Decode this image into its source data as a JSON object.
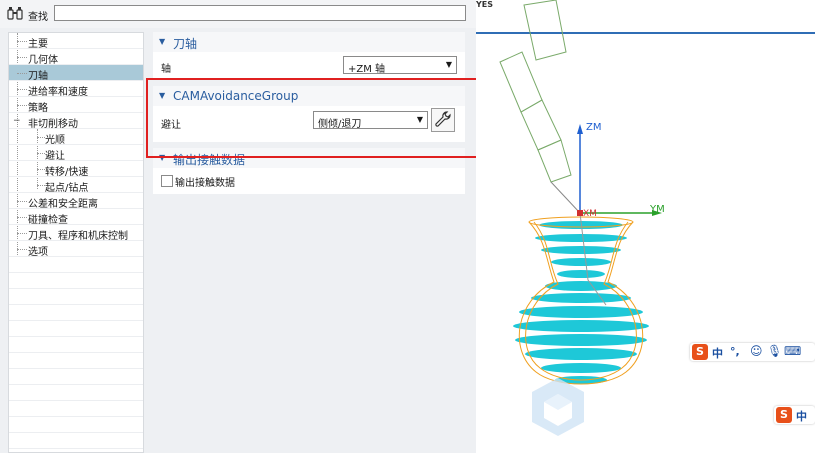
{
  "find": {
    "label": "查找",
    "value": ""
  },
  "tree": {
    "items": [
      {
        "label": "主要"
      },
      {
        "label": "几何体"
      },
      {
        "label": "刀轴"
      },
      {
        "label": "进给率和速度"
      },
      {
        "label": "策略"
      },
      {
        "label": "非切削移动"
      },
      {
        "label": "光顺"
      },
      {
        "label": "避让"
      },
      {
        "label": "转移/快速"
      },
      {
        "label": "起点/钻点"
      },
      {
        "label": "公差和安全距离"
      },
      {
        "label": "碰撞检查"
      },
      {
        "label": "刀具、程序和机床控制"
      },
      {
        "label": "选项"
      }
    ]
  },
  "tool_axis": {
    "title": "刀轴",
    "axis_label": "轴",
    "axis_value": "+ZM 轴"
  },
  "avoidance": {
    "title": "CAMAvoidanceGroup",
    "label": "避让",
    "value": "侧倾/退刀"
  },
  "contact": {
    "title": "输出接触数据",
    "checkbox_label": "输出接触数据",
    "checked": false
  },
  "viewport": {
    "top_text": "YES",
    "zm_label": "ZM",
    "ym_label": "YM",
    "xm_label": "XM"
  },
  "ime": {
    "char1": "中",
    "punct": "°,",
    "char2": "中"
  },
  "colors": {
    "accent": "#2a5d9f",
    "highlight": "#e02020",
    "selected_row": "#a9c9d8",
    "mesh": "#1ec8d8",
    "outline": "#f0a020"
  }
}
